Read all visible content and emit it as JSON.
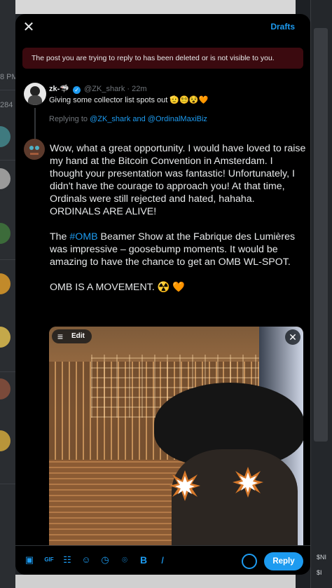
{
  "background": {
    "time_text": "8 PM",
    "count_text": "284",
    "right_fragments": [
      "$NI",
      "$I"
    ]
  },
  "modal": {
    "drafts_label": "Drafts",
    "alert_text": "The post you are trying to reply to has been deleted or is not visible to you."
  },
  "original_post": {
    "display_name": "zk-🦈",
    "handle": "@ZK_shark",
    "time": "· 22m",
    "text": "Giving some collector list spots out 🫡😵‍💫😵🧡",
    "replying_prefix": "Replying to ",
    "replying_mentions": "@ZK_shark and @OrdinalMaxiBiz"
  },
  "compose": {
    "p1": "Wow, what a great opportunity. I would have loved to raise my hand at the Bitcoin Convention in Amsterdam. I thought your presentation was fantastic! Unfortunately, I didn't have the courage to approach you! At that time, Ordinals were still rejected and hated, hahaha. ORDINALS ARE ALIVE!",
    "p2_tag": "#OMB",
    "p2_rest": " Beamer Show at the Fabrique des Lumières was impressive – goosebump moments. It would be amazing to have the chance to get an OMB WL-SPOT.",
    "p2_prefix": "The ",
    "p3": "OMB IS A MOVEMENT. ☢️  🧡"
  },
  "media": {
    "edit_label": "Edit"
  },
  "toolbar": {
    "icons": [
      "image-icon",
      "gif-icon",
      "poll-icon",
      "emoji-icon",
      "schedule-icon",
      "location-icon",
      "bold-icon",
      "italic-icon"
    ],
    "bold_glyph": "B",
    "italic_glyph": "I",
    "reply_label": "Reply"
  },
  "colors": {
    "accent": "#1d9bf0",
    "alert_bg": "#3b0a0f",
    "modal_bg": "#000000"
  }
}
